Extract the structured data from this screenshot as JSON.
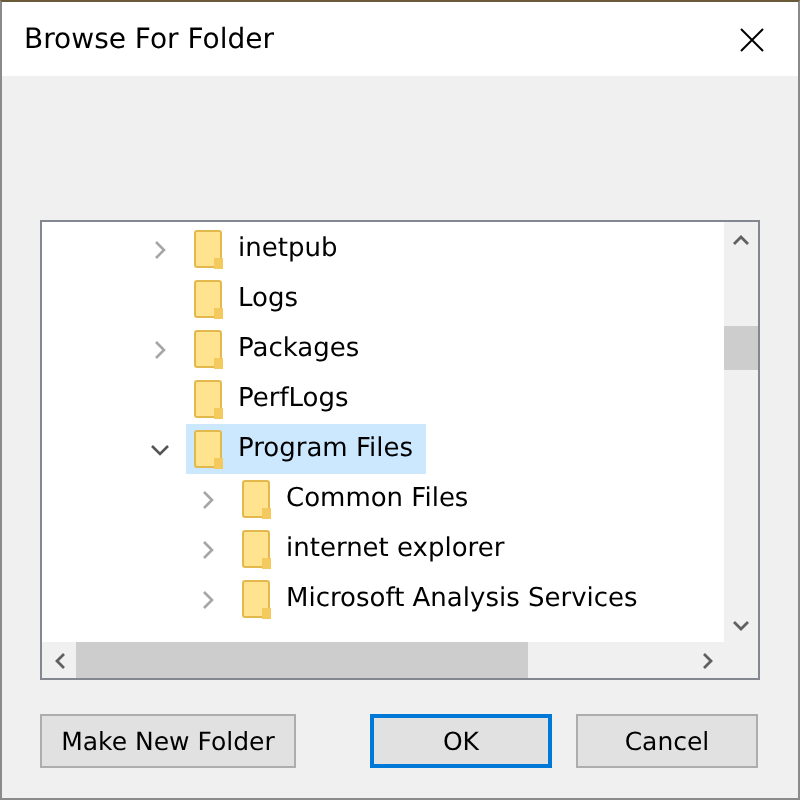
{
  "window": {
    "title": "Browse For Folder"
  },
  "tree": [
    {
      "label": "inetpub",
      "expanded": false,
      "selected": false
    },
    {
      "label": "Logs",
      "selected": false
    },
    {
      "label": "Packages",
      "expanded": false,
      "selected": false
    },
    {
      "label": "PerfLogs",
      "selected": false
    },
    {
      "label": "Program Files",
      "expanded": true,
      "selected": true,
      "children": [
        {
          "label": "Common Files",
          "expanded": false,
          "selected": false
        },
        {
          "label": "internet explorer",
          "expanded": false,
          "selected": false
        },
        {
          "label": "Microsoft Analysis Services",
          "expanded": false,
          "selected": false
        }
      ]
    }
  ],
  "buttons": [
    {
      "label": "Make New Folder",
      "focused": false
    },
    {
      "label": "OK",
      "focused": true
    },
    {
      "label": "Cancel",
      "focused": false
    }
  ]
}
